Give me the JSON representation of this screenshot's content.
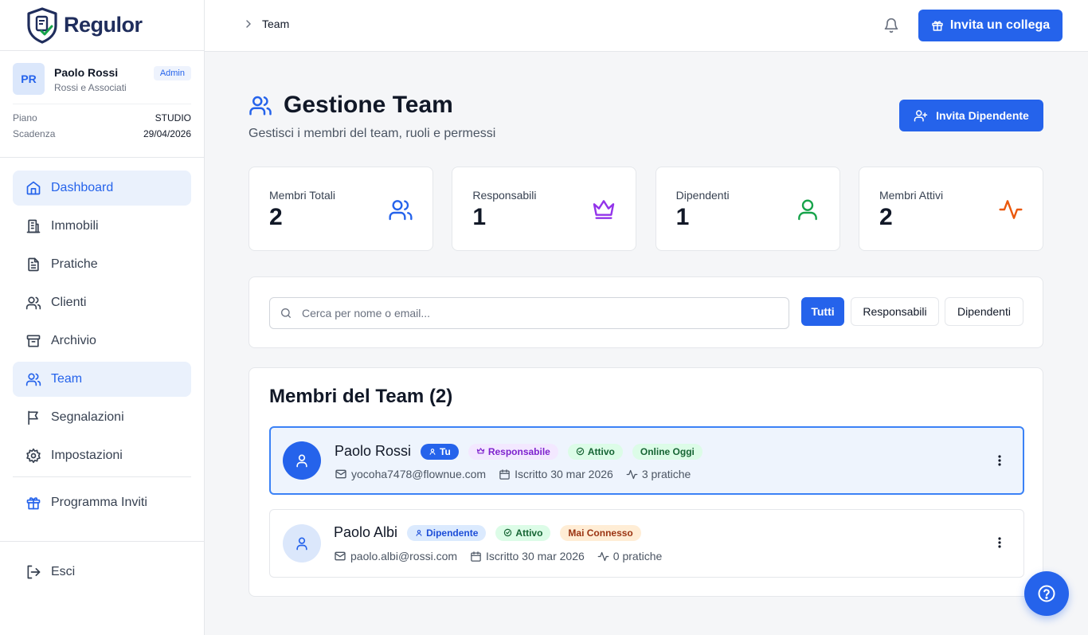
{
  "app": {
    "name": "Regulor"
  },
  "user": {
    "initials": "PR",
    "name": "Paolo Rossi",
    "org": "Rossi e Associati",
    "role_badge": "Admin"
  },
  "plan": {
    "plan_label": "Piano",
    "plan_value": "STUDIO",
    "expiry_label": "Scadenza",
    "expiry_value": "29/04/2026"
  },
  "sidebar": {
    "items": [
      {
        "label": "Dashboard",
        "icon": "home-icon"
      },
      {
        "label": "Immobili",
        "icon": "building-icon"
      },
      {
        "label": "Pratiche",
        "icon": "file-text-icon"
      },
      {
        "label": "Clienti",
        "icon": "users-icon"
      },
      {
        "label": "Archivio",
        "icon": "archive-icon"
      },
      {
        "label": "Team",
        "icon": "users-icon"
      },
      {
        "label": "Segnalazioni",
        "icon": "flag-icon"
      },
      {
        "label": "Impostazioni",
        "icon": "gear-icon"
      }
    ],
    "invite_program": "Programma Inviti",
    "logout": "Esci"
  },
  "topbar": {
    "breadcrumb": "Team",
    "invite_button": "Invita un collega"
  },
  "page": {
    "title": "Gestione Team",
    "subtitle": "Gestisci i membri del team, ruoli e permessi",
    "invite_button": "Invita Dipendente"
  },
  "stats": [
    {
      "label": "Membri Totali",
      "value": "2",
      "icon": "users-icon",
      "color": "#2563eb"
    },
    {
      "label": "Responsabili",
      "value": "1",
      "icon": "crown-icon",
      "color": "#9333ea"
    },
    {
      "label": "Dipendenti",
      "value": "1",
      "icon": "user-icon",
      "color": "#16a34a"
    },
    {
      "label": "Membri Attivi",
      "value": "2",
      "icon": "activity-icon",
      "color": "#ea580c"
    }
  ],
  "filters": {
    "search_placeholder": "Cerca per nome o email...",
    "buttons": [
      "Tutti",
      "Responsabili",
      "Dipendenti"
    ],
    "active": "Tutti"
  },
  "members": {
    "title": "Membri del Team (2)",
    "list": [
      {
        "name": "Paolo Rossi",
        "you_badge": "Tu",
        "role": "Responsabile",
        "status": "Attivo",
        "presence": "Online Oggi",
        "email": "yocoha7478@flownue.com",
        "joined": "Iscritto 30 mar 2026",
        "cases": "3 pratiche"
      },
      {
        "name": "Paolo Albi",
        "role": "Dipendente",
        "status": "Attivo",
        "presence": "Mai Connesso",
        "email": "paolo.albi@rossi.com",
        "joined": "Iscritto 30 mar 2026",
        "cases": "0 pratiche"
      }
    ]
  },
  "colors": {
    "primary": "#2563eb",
    "active_bg": "#eaf1fc"
  }
}
